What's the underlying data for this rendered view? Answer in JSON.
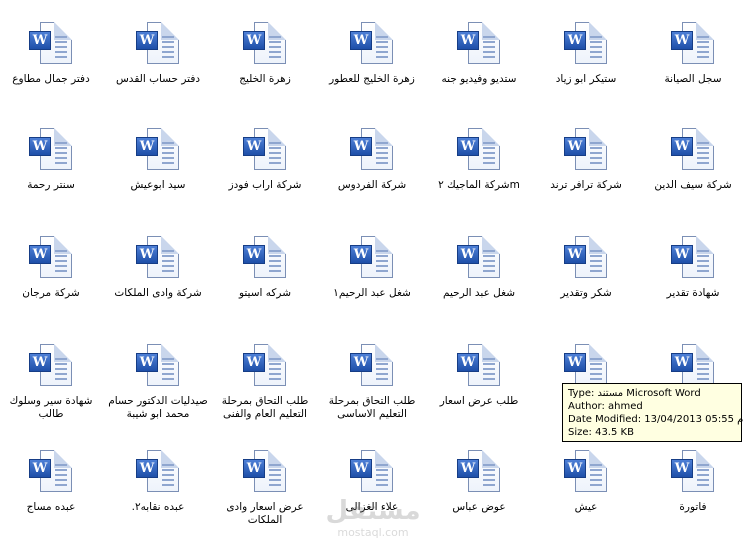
{
  "files": [
    {
      "label": "سجل الصيانة"
    },
    {
      "label": "ستيكر ابو زياد"
    },
    {
      "label": "ستديو وفيديو جنه"
    },
    {
      "label": "زهرة الخليج للعطور"
    },
    {
      "label": "زهرة الخليج"
    },
    {
      "label": "دفتر حساب القدس"
    },
    {
      "label": "دفتر جمال مطاوع"
    },
    {
      "label": "شركة سيف الدين"
    },
    {
      "label": "شركة ترافر ترند"
    },
    {
      "label": "mشركة الماجيك ٢"
    },
    {
      "label": "شركة الفردوس"
    },
    {
      "label": "شركة اراب فودز"
    },
    {
      "label": "سيد ابوعيش"
    },
    {
      "label": "سنتر رحمة"
    },
    {
      "label": "شهادة تقدير"
    },
    {
      "label": "شكر وتقدير"
    },
    {
      "label": "شغل عبد الرحيم"
    },
    {
      "label": "شغل عبد الرحيم١"
    },
    {
      "label": "شركه اسيتو"
    },
    {
      "label": "شركة وادى الملكات"
    },
    {
      "label": "شركة مرجان"
    },
    {
      "label": ""
    },
    {
      "label": ""
    },
    {
      "label": "طلب عرض اسعار"
    },
    {
      "label": "طلب التحاق بمرحلة التعليم الاساسى"
    },
    {
      "label": "طلب التحاق بمرحلة التعليم العام والفنى"
    },
    {
      "label": "صيدليات الدكتور حسام محمد ابو شيبة"
    },
    {
      "label": "شهادة سير وسلوك طالب"
    },
    {
      "label": "فاتورة"
    },
    {
      "label": "عيش"
    },
    {
      "label": "عوض عباس"
    },
    {
      "label": "علاء الغزالى"
    },
    {
      "label": "عرض اسعار وادى الملكات"
    },
    {
      "label": "عبده نقابه٢."
    },
    {
      "label": "عبده مساج"
    }
  ],
  "tooltip": {
    "type": "Type: مستند Microsoft Word",
    "author": "Author: ahmed",
    "date_modified": "Date Modified: 13/04/2013 05:55 م",
    "size": "Size: 43.5 KB"
  },
  "icon": {
    "name": "word-document-icon",
    "badge_letter": "W",
    "badge_color": "#2a5db8"
  },
  "watermark": {
    "main": "مستقل",
    "sub": "mostaql.com"
  }
}
